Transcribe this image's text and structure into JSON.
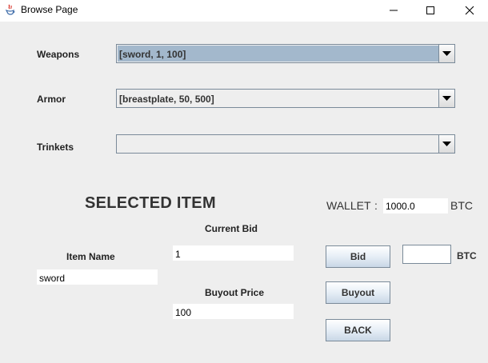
{
  "window": {
    "title": "Browse Page",
    "controls": [
      "minimize-icon",
      "maximize-icon",
      "close-icon"
    ]
  },
  "categories": {
    "weapons": {
      "label": "Weapons",
      "selected": "[sword, 1, 100]"
    },
    "armor": {
      "label": "Armor",
      "selected": "[breastplate, 50, 500]"
    },
    "trinkets": {
      "label": "Trinkets",
      "selected": ""
    }
  },
  "selected_item": {
    "heading": "SELECTED ITEM",
    "item_name_label": "Item Name",
    "item_name": "sword",
    "current_bid_label": "Current Bid",
    "current_bid": "1",
    "buyout_price_label": "Buyout Price",
    "buyout_price": "100"
  },
  "wallet": {
    "label": "WALLET",
    "colon": ":",
    "value": "1000.0",
    "unit": "BTC"
  },
  "actions": {
    "bid_label": "Bid",
    "bid_amount": "",
    "bid_unit": "BTC",
    "buyout_label": "Buyout",
    "back_label": "BACK"
  },
  "colors": {
    "background": "#eeeeee",
    "combo_selection": "#a3b8cc",
    "border": "#7a8a99"
  }
}
